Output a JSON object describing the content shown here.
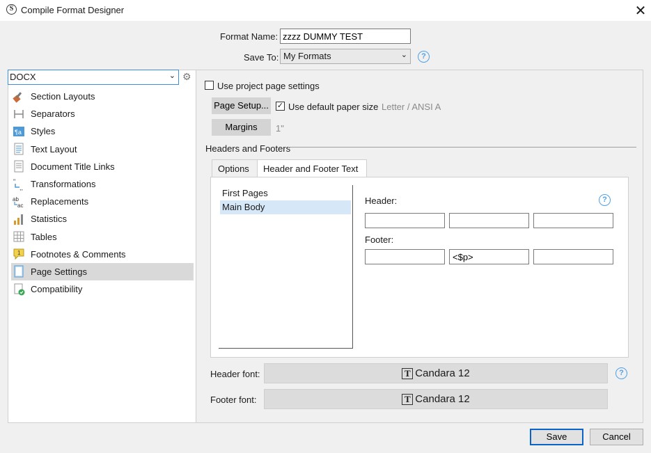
{
  "window": {
    "title": "Compile Format Designer",
    "logo": "S"
  },
  "form": {
    "format_name_label": "Format Name:",
    "format_name_value": "zzzz DUMMY TEST",
    "save_to_label": "Save To:",
    "save_to_value": "My Formats",
    "help_glyph": "?"
  },
  "format_select": {
    "value": "DOCX"
  },
  "sidebar": {
    "items": [
      {
        "label": "Section Layouts",
        "icon": "brush-icon"
      },
      {
        "label": "Separators",
        "icon": "separator-icon"
      },
      {
        "label": "Styles",
        "icon": "styles-icon"
      },
      {
        "label": "Text Layout",
        "icon": "text-layout-icon"
      },
      {
        "label": "Document Title Links",
        "icon": "document-icon"
      },
      {
        "label": "Transformations",
        "icon": "transformations-icon"
      },
      {
        "label": "Replacements",
        "icon": "replacements-icon"
      },
      {
        "label": "Statistics",
        "icon": "statistics-icon"
      },
      {
        "label": "Tables",
        "icon": "table-icon"
      },
      {
        "label": "Footnotes & Comments",
        "icon": "footnote-icon"
      },
      {
        "label": "Page Settings",
        "icon": "page-settings-icon",
        "selected": true
      },
      {
        "label": "Compatibility",
        "icon": "compatibility-icon"
      }
    ]
  },
  "page_settings": {
    "use_project_label": "Use project page settings",
    "use_project_checked": false,
    "page_setup_button": "Page Setup...",
    "default_paper_label": "Use default paper size",
    "default_paper_checked": true,
    "paper_size": "Letter / ANSI A",
    "margins_button": "Margins",
    "margins_value": "1\"",
    "section_title": "Headers and Footers"
  },
  "tabs": [
    {
      "label": "Options",
      "active": false
    },
    {
      "label": "Header and Footer Text",
      "active": true
    }
  ],
  "pages": [
    {
      "label": "First Pages",
      "selected": false
    },
    {
      "label": "Main Body",
      "selected": true
    }
  ],
  "header_footer": {
    "header_label": "Header:",
    "footer_label": "Footer:",
    "header_fields": [
      "",
      "",
      ""
    ],
    "footer_fields": [
      "",
      "<$p>",
      ""
    ]
  },
  "fonts": {
    "header_font_label": "Header font:",
    "header_font_value": "Candara 12",
    "footer_font_label": "Footer font:",
    "footer_font_value": "Candara 12",
    "font_icon_glyph": "T"
  },
  "buttons": {
    "save": "Save",
    "cancel": "Cancel"
  },
  "colors": {
    "accent": "#0a64c8",
    "help": "#4ea1e6",
    "selection": "#d6e8f7"
  }
}
